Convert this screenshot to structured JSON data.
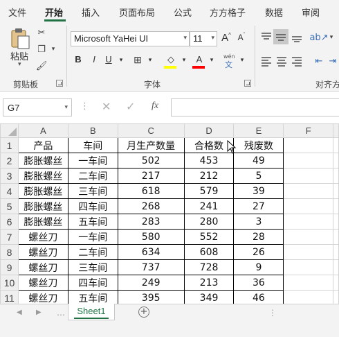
{
  "menu": {
    "tabs": [
      "文件",
      "开始",
      "插入",
      "页面布局",
      "公式",
      "方方格子",
      "数据",
      "审阅"
    ],
    "active": "开始"
  },
  "ribbon": {
    "clipboard": {
      "paste_label": "粘贴",
      "group_label": "剪贴板"
    },
    "font": {
      "family": "Microsoft YaHei UI",
      "size": "11",
      "bold": "B",
      "italic": "I",
      "underline": "U",
      "grow": "A",
      "shrink": "A",
      "font_color_letter": "A",
      "fill_color": "#ffff00",
      "font_color": "#ff0000",
      "wen": "wén",
      "wen_char": "文",
      "group_label": "字体"
    },
    "alignment": {
      "group_label": "对齐方"
    }
  },
  "formula_bar": {
    "name_box": "G7",
    "fx": "fx",
    "formula": ""
  },
  "sheet": {
    "columns": [
      "A",
      "B",
      "C",
      "D",
      "E",
      "F"
    ],
    "header": [
      "产品",
      "车间",
      "月生产数量",
      "合格数",
      "残废数"
    ],
    "rows": [
      {
        "num": "1",
        "cells": [
          "产品",
          "车间",
          "月生产数量",
          "合格数",
          "残废数"
        ]
      },
      {
        "num": "2",
        "cells": [
          "膨胀螺丝",
          "一车间",
          "502",
          "453",
          "49"
        ]
      },
      {
        "num": "3",
        "cells": [
          "膨胀螺丝",
          "二车间",
          "217",
          "212",
          "5"
        ]
      },
      {
        "num": "4",
        "cells": [
          "膨胀螺丝",
          "三车间",
          "618",
          "579",
          "39"
        ]
      },
      {
        "num": "5",
        "cells": [
          "膨胀螺丝",
          "四车间",
          "268",
          "241",
          "27"
        ]
      },
      {
        "num": "6",
        "cells": [
          "膨胀螺丝",
          "五车间",
          "283",
          "280",
          "3"
        ]
      },
      {
        "num": "7",
        "cells": [
          "螺丝刀",
          "一车间",
          "580",
          "552",
          "28"
        ]
      },
      {
        "num": "8",
        "cells": [
          "螺丝刀",
          "二车间",
          "634",
          "608",
          "26"
        ]
      },
      {
        "num": "9",
        "cells": [
          "螺丝刀",
          "三车间",
          "737",
          "728",
          "9"
        ]
      },
      {
        "num": "10",
        "cells": [
          "螺丝刀",
          "四车间",
          "249",
          "213",
          "36"
        ]
      },
      {
        "num": "11",
        "cells": [
          "螺丝刀",
          "五车间",
          "395",
          "349",
          "46"
        ]
      }
    ]
  },
  "sheet_tabs": {
    "active": "Sheet1",
    "add": "+"
  },
  "colors": {
    "accent": "#217346"
  }
}
